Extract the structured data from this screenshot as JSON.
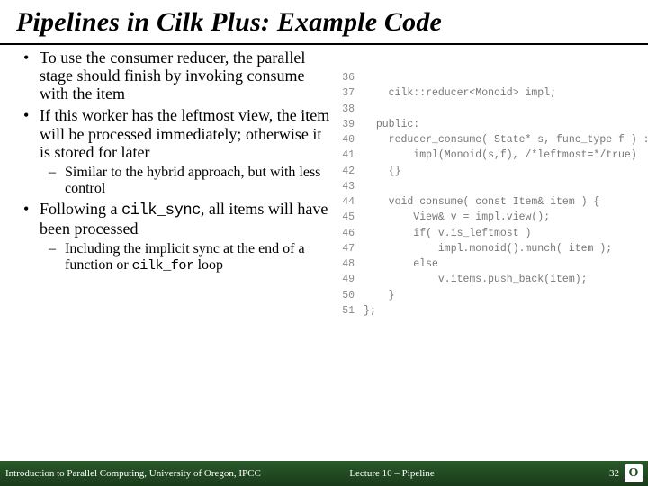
{
  "title": "Pipelines in Cilk Plus: Example Code",
  "bullets": {
    "b1": "To use the consumer reducer, the parallel stage should finish by invoking consume with the item",
    "b2": "If this worker has the leftmost view, the item will be processed immediately; otherwise it is stored for later",
    "b2s1": "Similar to the hybrid approach, but with less control",
    "b3a": "Following a ",
    "b3code": "cilk_sync",
    "b3b": ", all items will have been processed",
    "b3s1a": "Including the implicit sync at the end of a function or ",
    "b3s1code": "cilk_for",
    "b3s1b": " loop"
  },
  "code": [
    {
      "n": "36",
      "t": ""
    },
    {
      "n": "37",
      "t": "    cilk::reducer<Monoid> impl;"
    },
    {
      "n": "38",
      "t": ""
    },
    {
      "n": "39",
      "t": "  public:"
    },
    {
      "n": "40",
      "t": "    reducer_consume( State* s, func_type f ) :"
    },
    {
      "n": "41",
      "t": "        impl(Monoid(s,f), /*leftmost=*/true)"
    },
    {
      "n": "42",
      "t": "    {}"
    },
    {
      "n": "43",
      "t": ""
    },
    {
      "n": "44",
      "t": "    void consume( const Item& item ) {"
    },
    {
      "n": "45",
      "t": "        View& v = impl.view();"
    },
    {
      "n": "46",
      "t": "        if( v.is_leftmost )"
    },
    {
      "n": "47",
      "t": "            impl.monoid().munch( item );"
    },
    {
      "n": "48",
      "t": "        else"
    },
    {
      "n": "49",
      "t": "            v.items.push_back(item);"
    },
    {
      "n": "50",
      "t": "    }"
    },
    {
      "n": "51",
      "t": "};"
    }
  ],
  "footer": {
    "left": "Introduction to Parallel Computing, University of Oregon, IPCC",
    "mid": "Lecture 10 – Pipeline",
    "page": "32",
    "logo": "O"
  }
}
